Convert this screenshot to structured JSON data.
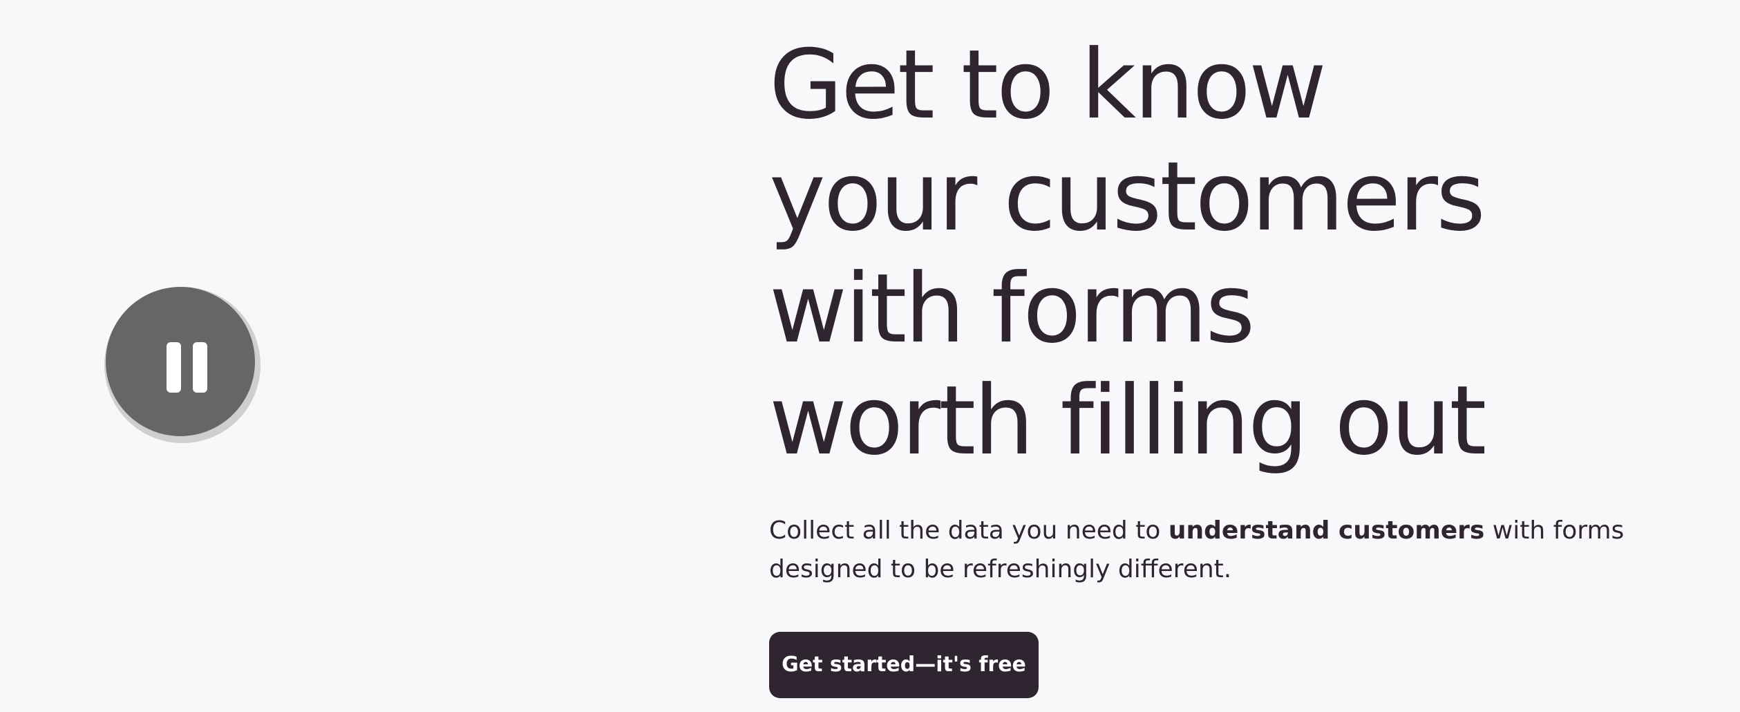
{
  "media_control": {
    "icon": "pause-icon",
    "state": "playing"
  },
  "hero": {
    "headline_lines": [
      "Get to know",
      "your customers",
      "with forms",
      "worth filling out"
    ],
    "subtext_before": "Collect all the data you need to ",
    "subtext_bold": "understand customers",
    "subtext_after": " with forms designed to be refreshingly different.",
    "cta_label": "Get started—it's free"
  },
  "colors": {
    "background": "#f8f8fa",
    "text": "#2f2530",
    "button_background": "#2f2530",
    "button_text": "#ffffff",
    "pause_button": "#666667"
  }
}
